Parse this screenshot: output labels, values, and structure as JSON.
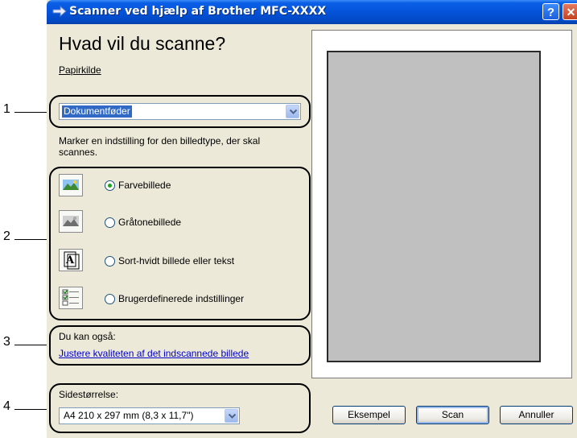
{
  "callouts": [
    "1",
    "2",
    "3",
    "4"
  ],
  "window": {
    "title": "Scanner ved hjælp af Brother MFC-XXXX",
    "help_label": "?",
    "close_label": "✕"
  },
  "heading": "Hvad vil du scanne?",
  "paper_source": {
    "label": "Papirkilde",
    "value": "Dokumentføder"
  },
  "instruction": [
    "Marker en indstilling for den billedtype, der skal",
    "scannes."
  ],
  "image_types": [
    {
      "label": "Farvebillede",
      "selected": true,
      "icon": "color-photo-icon"
    },
    {
      "label": "Gråtonebillede",
      "selected": false,
      "icon": "grayscale-photo-icon"
    },
    {
      "label": "Sort-hvidt billede eller tekst",
      "selected": false,
      "icon": "black-white-text-icon"
    },
    {
      "label": "Brugerdefinerede indstillinger",
      "selected": false,
      "icon": "custom-settings-icon"
    }
  ],
  "also": {
    "label": "Du kan også:",
    "link": "Justere kvaliteten af det indscannede billede"
  },
  "page_size": {
    "label": "Sidestørrelse:",
    "value": "A4 210 x 297 mm (8,3 x 11,7\")"
  },
  "buttons": {
    "preview": "Eksempel",
    "scan": "Scan",
    "cancel": "Annuller"
  },
  "colors": {
    "title_bar": "#0553d9",
    "dialog_bg": "#ece9d8",
    "selection": "#316ac5",
    "link": "#0000cc",
    "preview_area": "#c0c0c0"
  }
}
